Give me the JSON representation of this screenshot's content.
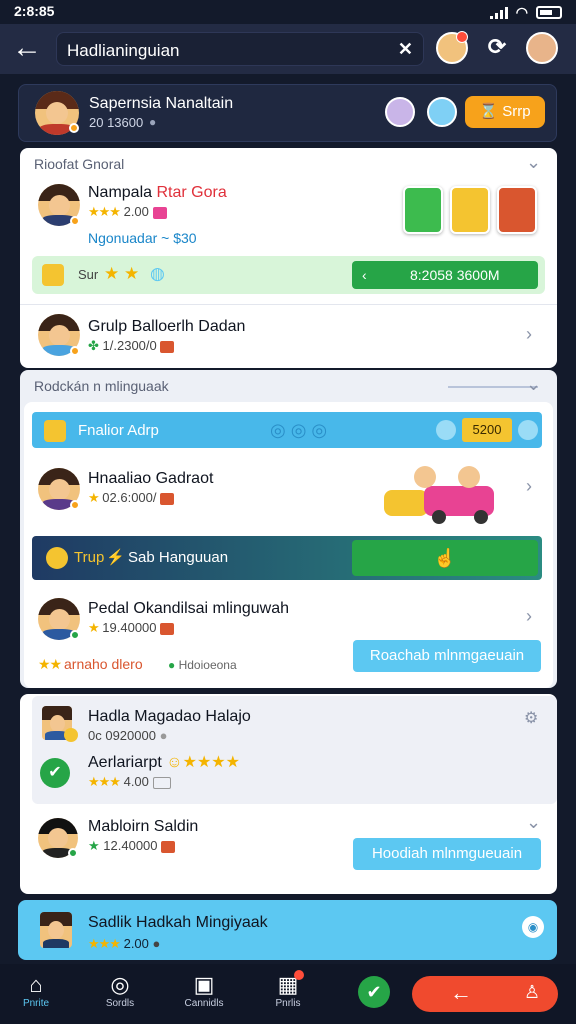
{
  "status": {
    "time": "2:8:85"
  },
  "topbar": {
    "search_value": "Hadlianinguian",
    "clear": "✕",
    "back": "←",
    "refresh": "⟳"
  },
  "profile": {
    "name": "Sapernsia Nanaltain",
    "points": "20 13600",
    "action": "Srrp"
  },
  "section1": {
    "title": "Rioofat Gnoral",
    "item1": {
      "name_a": "Nampala ",
      "name_b": "Rtar Gora",
      "rating": "2.00",
      "link": "Ngonuadar ~ $30"
    },
    "promo": {
      "label": "Sur",
      "button": "8:2058 3600M"
    },
    "item2": {
      "name": "Grulp Balloerlh Dadan",
      "count": "1/.2300/0"
    }
  },
  "section2": {
    "title": "Rodckán n mlinguaak",
    "banner": {
      "label": "Fnalior Adrp",
      "value": "5200"
    },
    "item1": {
      "name": "Hnaaliao Gadraot",
      "rating": "02.6:000/"
    },
    "promo": {
      "label": "Trup",
      "label2": "Sab Hanguuan"
    },
    "item2": {
      "name": "Pedal Okandilsai mlinguwah",
      "count": "19.40000"
    },
    "footer": {
      "label": "arnaho dlero",
      "tag": "Hdoioeona",
      "button": "Roachab mlnmgaeuain"
    }
  },
  "section3": {
    "item1": {
      "name": "Hadla Magadao Halajo",
      "count": "0c 0920000"
    },
    "item2": {
      "name": "Aerlariarpt",
      "rating": "4.00"
    },
    "item3": {
      "name": "Mabloirn Saldin",
      "count": "12.40000",
      "button": "Hoodiah mlnmgueuain"
    }
  },
  "highlight": {
    "name": "Sadlik Hadkah Mingiyaak",
    "rating": "2.00"
  },
  "nav": [
    {
      "label": "Pnrite",
      "icon": "⌂"
    },
    {
      "label": "Sordls",
      "icon": "◎"
    },
    {
      "label": "Cannidls",
      "icon": "▣"
    },
    {
      "label": "Pnrlis",
      "icon": "▦"
    }
  ],
  "colors": {
    "accent": "#26a547",
    "brand": "#232b44",
    "orange": "#f7a21b",
    "red": "#f04a2e",
    "sky": "#5cc8f2"
  }
}
